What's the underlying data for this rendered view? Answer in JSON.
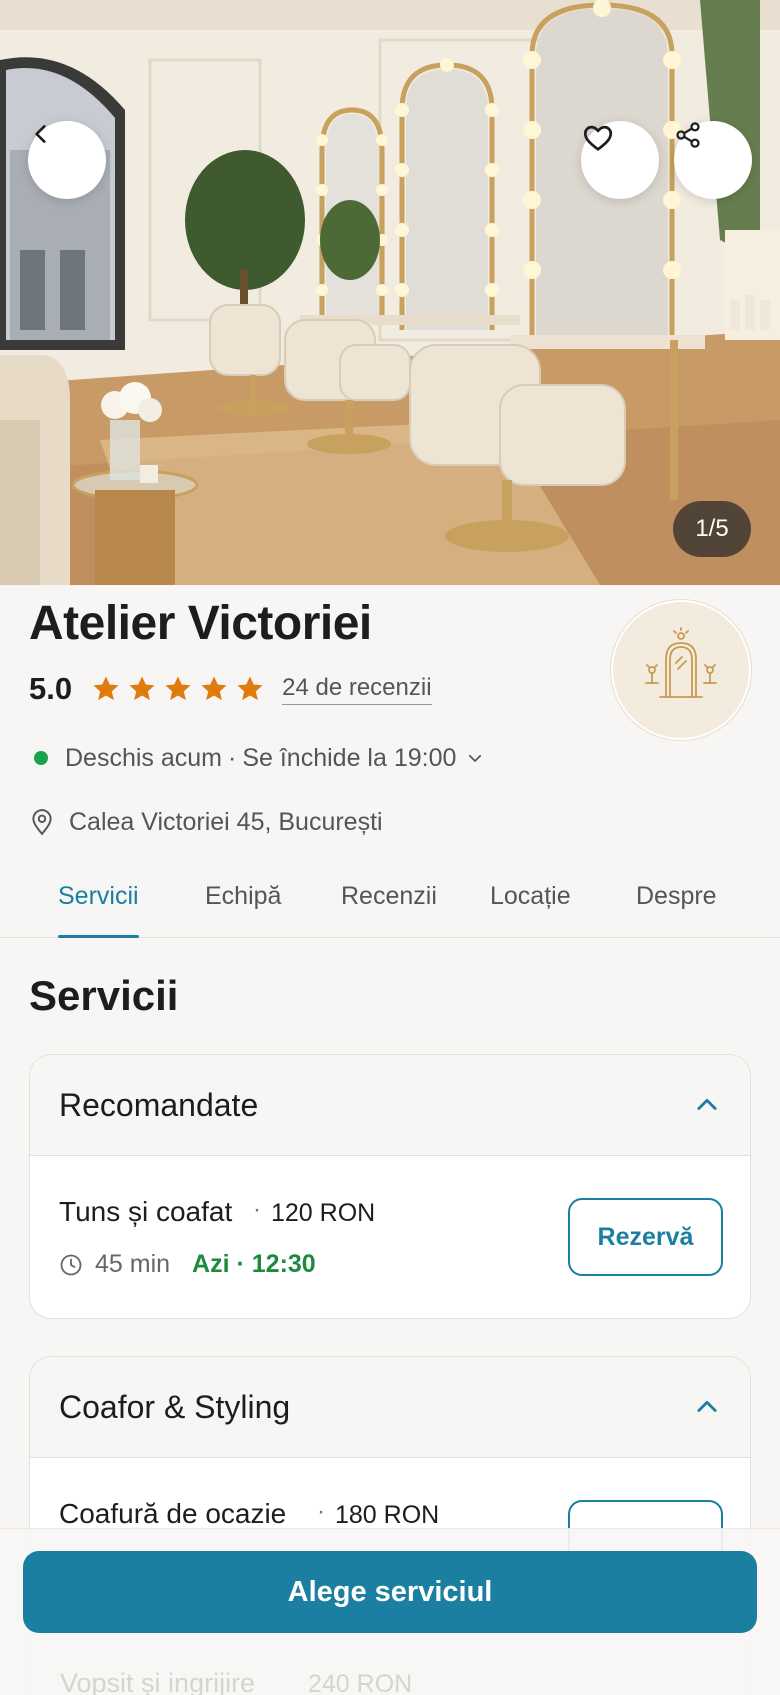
{
  "gallery": {
    "counter": "1/5",
    "back_icon": "chevron-left-icon",
    "favorite_icon": "heart-icon",
    "share_icon": "share-icon"
  },
  "salon": {
    "name": "Atelier Victoriei",
    "rating": "5.0",
    "stars": 5,
    "reviews_label": "24 de recenzii",
    "status_open": "Deschis acum",
    "status_separator": "·",
    "status_closes": "Se închide la 19:00",
    "address": "Calea Victoriei 45, București"
  },
  "tabs": [
    {
      "label": "Servicii",
      "active": true
    },
    {
      "label": "Echipă",
      "active": false
    },
    {
      "label": "Recenzii",
      "active": false
    },
    {
      "label": "Locație",
      "active": false
    },
    {
      "label": "Despre",
      "active": false
    }
  ],
  "services": {
    "title": "Servicii",
    "groups": [
      {
        "title": "Recomandate",
        "items": [
          {
            "name": "Tuns și coafat",
            "separator": "·",
            "price": "120 RON",
            "duration": "45 min",
            "slot": "Azi · 12:30",
            "button": "Rezervă"
          }
        ]
      },
      {
        "title": "Coafor & Styling",
        "items": [
          {
            "name": "Coafură de ocazie",
            "separator": "·",
            "price": "180 RON"
          },
          {
            "name": "Vopsit și ingrijire",
            "price": "240 RON"
          }
        ]
      }
    ]
  },
  "cta": {
    "label": "Alege serviciul"
  },
  "colors": {
    "accent": "#1a7fa0",
    "open_status": "#1aa34a",
    "slot_green": "#1e8a3d",
    "star": "#e07b0e"
  }
}
